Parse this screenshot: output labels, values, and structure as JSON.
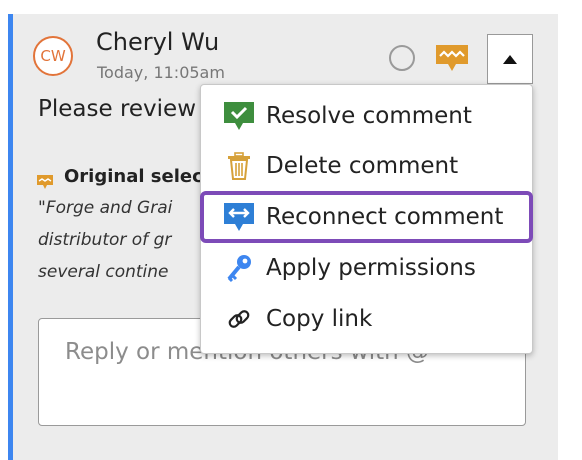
{
  "colors": {
    "panel_bg": "#ececec",
    "accent_bar": "#3d86f0",
    "avatar": "#e2743a",
    "highlight": "#7d4bb8",
    "resolve_icon": "#3e8e3e",
    "delete_icon": "#d6a13a",
    "reconnect_icon": "#2e7fd6",
    "permissions_icon": "#3d86f0",
    "comment_icon": "#e09a2c"
  },
  "comment": {
    "avatar_initials": "CW",
    "author": "Cheryl Wu",
    "timestamp": "Today, 11:05am",
    "body": "Please review",
    "original_selection_label": "Original selec",
    "quote_lines": [
      "\"Forge and Grai",
      "distributor of gr",
      "several contine"
    ]
  },
  "header_icons": {
    "resolve": "resolve-circle-icon",
    "reconnect": "reconnect-comment-icon",
    "menu": "caret-up-icon"
  },
  "reply": {
    "placeholder": "Reply or mention others with @"
  },
  "menu": {
    "items": [
      {
        "label": "Resolve comment",
        "icon": "check-comment-icon"
      },
      {
        "label": "Delete comment",
        "icon": "trash-icon"
      },
      {
        "label": "Reconnect comment",
        "icon": "reconnect-icon"
      },
      {
        "label": "Apply permissions",
        "icon": "key-icon"
      },
      {
        "label": "Copy link",
        "icon": "link-icon"
      }
    ]
  }
}
